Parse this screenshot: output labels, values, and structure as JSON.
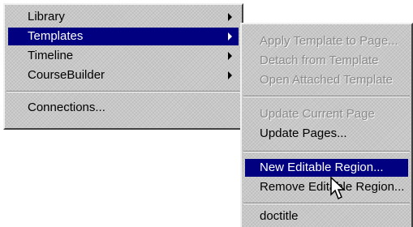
{
  "main_menu": {
    "items": [
      {
        "label": "Library",
        "submenu": true
      },
      {
        "label": "Templates",
        "submenu": true
      },
      {
        "label": "Timeline",
        "submenu": true
      },
      {
        "label": "CourseBuilder",
        "submenu": true
      },
      {
        "label": "Connections...",
        "submenu": false
      }
    ],
    "selected": "Templates"
  },
  "templates_submenu": {
    "items": [
      {
        "label": "Apply Template to Page...",
        "enabled": false
      },
      {
        "label": "Detach from Template",
        "enabled": false
      },
      {
        "label": "Open Attached Template",
        "enabled": false
      },
      {
        "label": "Update Current Page",
        "enabled": false
      },
      {
        "label": "Update Pages...",
        "enabled": true
      },
      {
        "label": "New Editable Region...",
        "enabled": true
      },
      {
        "label": "Remove Editable Region...",
        "enabled": true
      },
      {
        "label": "doctitle",
        "enabled": true
      }
    ],
    "highlighted": "New Editable Region..."
  },
  "colors": {
    "menu_face": "#c8c8c8",
    "highlight": "#000080",
    "disabled_text": "#8a8a8a"
  }
}
